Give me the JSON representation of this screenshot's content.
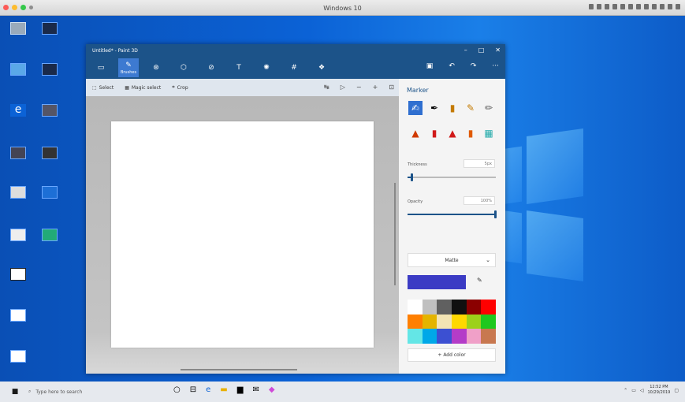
{
  "mac": {
    "title": "Windows 10"
  },
  "paint": {
    "title": "Untitled* - Paint 3D",
    "ribbon": {
      "active_label": "Brushes"
    },
    "toolbar": {
      "select": "Select",
      "magic_select": "Magic select",
      "crop": "Crop"
    },
    "panel": {
      "title": "Marker",
      "thickness_label": "Thickness",
      "thickness_value": "5px",
      "thickness_level": 0.05,
      "opacity_label": "Opacity",
      "opacity_value": "100%",
      "opacity_level": 1.0,
      "finish": "Matte",
      "add_color": "Add color",
      "current_color": "#3b3bc4",
      "palette": [
        "#ffffff",
        "#c0c0c0",
        "#606060",
        "#101010",
        "#8b0000",
        "#ff0000",
        "#ff7f00",
        "#e4b400",
        "#f3e4b4",
        "#ffd800",
        "#9cd11a",
        "#1ec81e",
        "#64e6e6",
        "#00a8e8",
        "#3c50d2",
        "#b43cc8",
        "#f0a0c8",
        "#c87850"
      ]
    }
  },
  "taskbar": {
    "search_placeholder": "Type here to search",
    "time": "12:52 PM",
    "date": "10/29/2019"
  }
}
